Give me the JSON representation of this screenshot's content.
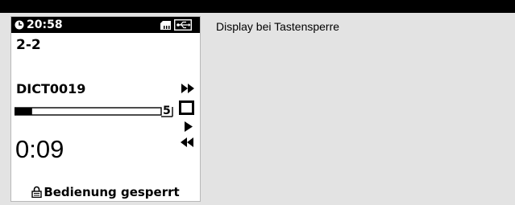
{
  "status": {
    "time": "20:58",
    "clock_icon": "clock-icon",
    "card_icon": "memory-card-icon",
    "usb_icon": "usb-icon"
  },
  "folder": "2-2",
  "file": {
    "name": "DICT0019",
    "count": "5",
    "progress_fraction": 0.12
  },
  "controls": [
    "fast-forward-icon",
    "stop-icon",
    "play-icon",
    "rewind-icon"
  ],
  "elapsed": "0:09",
  "lock": {
    "icon": "lock-icon",
    "text": "Bedienung gesperrt"
  },
  "caption": "Display bei Tastensperre"
}
